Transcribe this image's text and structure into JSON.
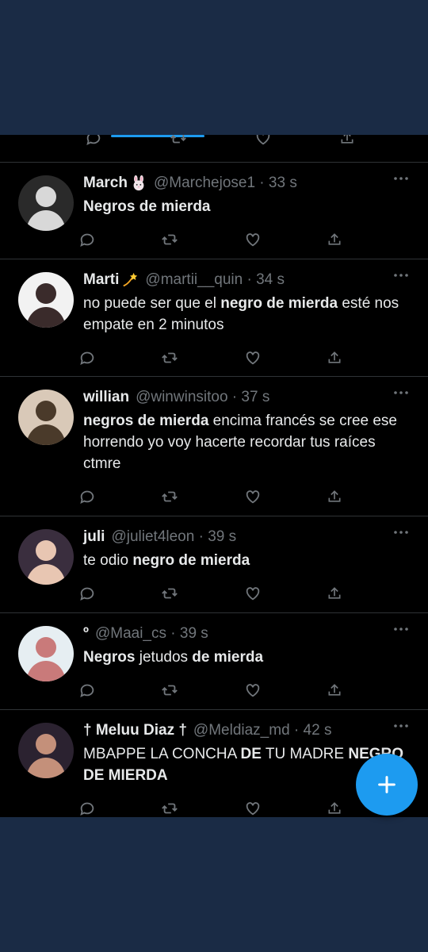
{
  "colors": {
    "background_outer": "#1a2b45",
    "timeline_bg": "#000000",
    "text_primary": "#e7e9ea",
    "text_secondary": "#71767b",
    "accent": "#1d9bf0",
    "divider": "#2f3336"
  },
  "tweets": [
    {
      "name": "March",
      "emoji": "rabbit-face",
      "handle": "@Marchejose1 · 33 s",
      "segments": [
        {
          "t": "Negros de mierda",
          "b": true
        }
      ]
    },
    {
      "name": "Marti",
      "emoji": "dizzy-star",
      "handle": "@martii__quin · 34 s",
      "segments": [
        {
          "t": "no puede ser que el ",
          "b": false
        },
        {
          "t": "negro de mierda",
          "b": true
        },
        {
          "t": " esté nos empate en 2 minutos",
          "b": false
        }
      ]
    },
    {
      "name": "willian",
      "emoji": "",
      "handle": "@winwinsitoo · 37 s",
      "segments": [
        {
          "t": "negros de mierda",
          "b": true
        },
        {
          "t": " encima francés se cree ese horrendo yo voy hacerte recordar tus raíces ctmre",
          "b": false
        }
      ]
    },
    {
      "name": "juli",
      "emoji": "",
      "handle": "@juliet4leon · 39 s",
      "segments": [
        {
          "t": "te odio ",
          "b": false
        },
        {
          "t": "negro de mierda",
          "b": true
        }
      ]
    },
    {
      "name": "º",
      "emoji": "",
      "handle": "@Maai_cs · 39 s",
      "segments": [
        {
          "t": "Negros",
          "b": true
        },
        {
          "t": " jetudos ",
          "b": false
        },
        {
          "t": "de mierda",
          "b": true
        }
      ]
    },
    {
      "name": "† Meluu Diaz †",
      "emoji": "",
      "handle": "@Meldiaz_md · 42 s",
      "segments": [
        {
          "t": "MBAPPE LA CONCHA ",
          "b": false
        },
        {
          "t": "DE",
          "b": true
        },
        {
          "t": " TU MADRE ",
          "b": false
        },
        {
          "t": "NEGRO DE MIERDA",
          "b": true
        }
      ]
    }
  ],
  "actions": [
    "reply-icon",
    "retweet-icon",
    "like-icon",
    "share-icon"
  ],
  "fab_icon": "plus-icon"
}
